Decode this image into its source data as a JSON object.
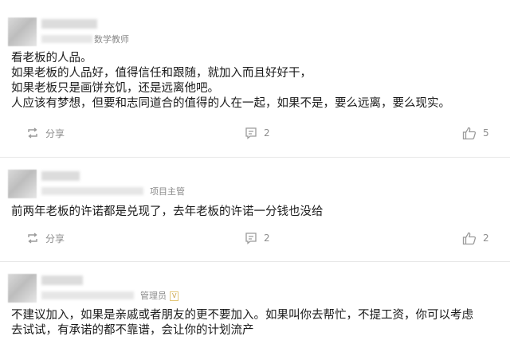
{
  "comments": [
    {
      "role": "数学教师",
      "lines": [
        "看老板的人品。",
        "如果老板的人品好，值得信任和跟随，就加入而且好好干，",
        "如果老板只是画饼充饥，还是远离他吧。",
        "人应该有梦想，但要和志同道合的值得的人在一起，如果不是，要么远离，要么现实。"
      ],
      "share_label": "分享",
      "comment_count": "2",
      "like_count": "5"
    },
    {
      "role": "项目主管",
      "lines": [
        "前两年老板的许诺都是兑现了，去年老板的许诺一分钱也没给"
      ],
      "share_label": "分享",
      "comment_count": "2",
      "like_count": "2"
    },
    {
      "role": "管理员",
      "badge": "V",
      "lines": [
        "不建议加入，如果是亲戚或者朋友的更不要加入。如果叫你去帮忙，不提工资，你可以考虑",
        "去试试，有承诺的都不靠谱，会让你的计划流产"
      ]
    }
  ],
  "icons": {
    "share": "share-icon",
    "comment": "comment-icon",
    "like": "thumbs-up-icon"
  },
  "colors": {
    "text": "#1a1a1a",
    "muted": "#8d8d8d",
    "separator": "#e8e8e8"
  }
}
